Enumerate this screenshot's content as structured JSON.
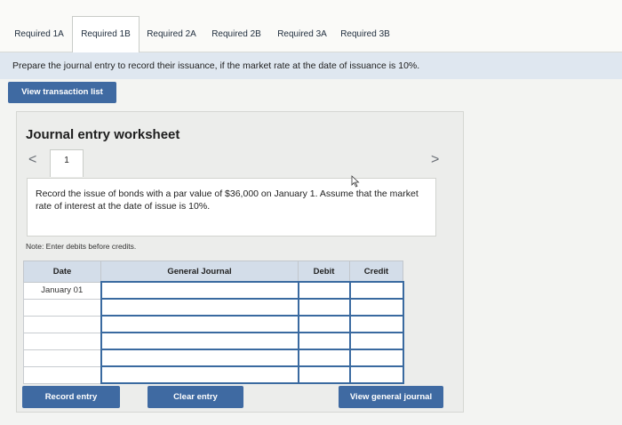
{
  "tabs": [
    {
      "label": "Required 1A",
      "active": false
    },
    {
      "label": "Required 1B",
      "active": true
    },
    {
      "label": "Required 2A",
      "active": false
    },
    {
      "label": "Required 2B",
      "active": false
    },
    {
      "label": "Required 3A",
      "active": false
    },
    {
      "label": "Required 3B",
      "active": false
    }
  ],
  "instruction": "Prepare the journal entry to record their issuance, if the market rate at the date of issuance is 10%.",
  "view_transaction_list_label": "View transaction list",
  "worksheet": {
    "title": "Journal entry worksheet",
    "prev_icon": "<",
    "next_icon": ">",
    "page_number": "1",
    "description": "Record the issue of bonds with a par value of $36,000 on January 1. Assume that the market rate of interest at the date of issue is 10%.",
    "note": "Note: Enter debits before credits."
  },
  "table": {
    "headers": [
      "Date",
      "General Journal",
      "Debit",
      "Credit"
    ],
    "rows": [
      {
        "date": "January 01",
        "account": "",
        "debit": "",
        "credit": ""
      },
      {
        "date": "",
        "account": "",
        "debit": "",
        "credit": ""
      },
      {
        "date": "",
        "account": "",
        "debit": "",
        "credit": ""
      },
      {
        "date": "",
        "account": "",
        "debit": "",
        "credit": ""
      },
      {
        "date": "",
        "account": "",
        "debit": "",
        "credit": ""
      },
      {
        "date": "",
        "account": "",
        "debit": "",
        "credit": ""
      }
    ]
  },
  "buttons": {
    "record_entry": "Record entry",
    "clear_entry": "Clear entry",
    "view_general_journal": "View general journal"
  },
  "colors": {
    "button_blue": "#3f6aa2",
    "header_fill": "#d3dde9",
    "input_border": "#3a6aa0",
    "instruction_band": "#dfe7f0"
  }
}
